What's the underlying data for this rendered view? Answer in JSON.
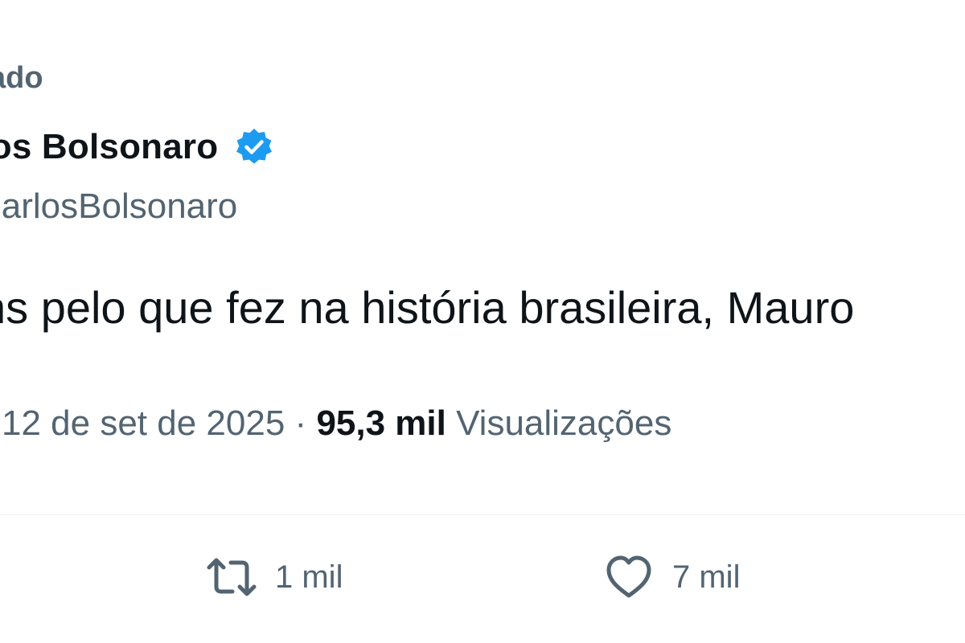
{
  "post": {
    "pinned_label": "ado",
    "author": {
      "display_name": "rlos Bolsonaro",
      "handle": "CarlosBolsonaro",
      "verified": true
    },
    "text": "ns pelo que fez na história brasileira, Mauro",
    "date": "12 de set de 2025",
    "separator": "·",
    "views_count": "95,3 mil",
    "views_label": "Visualizações"
  },
  "actions": {
    "retweet": {
      "icon": "retweet-icon",
      "count": "1 mil"
    },
    "like": {
      "icon": "heart-icon",
      "count": "7 mil"
    }
  },
  "colors": {
    "text_primary": "#0f1419",
    "text_secondary": "#536471",
    "verified_badge": "#1d9bf0",
    "divider": "#eff3f4"
  }
}
